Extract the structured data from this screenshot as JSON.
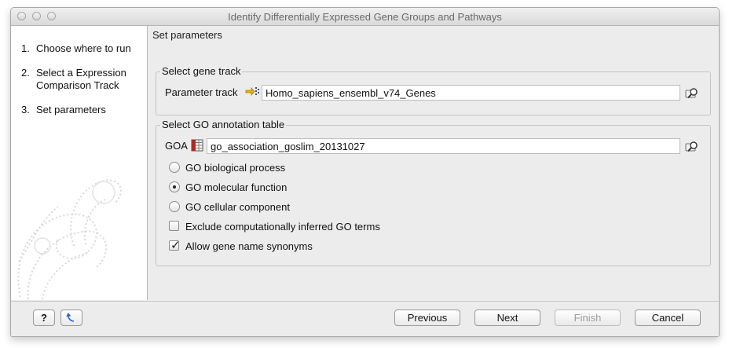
{
  "window": {
    "title": "Identify Differentially Expressed Gene Groups and Pathways"
  },
  "sidebar": {
    "steps": [
      {
        "num": "1.",
        "label": "Choose where to run"
      },
      {
        "num": "2.",
        "label": "Select a Expression Comparison Track"
      },
      {
        "num": "3.",
        "label": "Set parameters"
      }
    ]
  },
  "main": {
    "title": "Set parameters",
    "gene_track_group": {
      "legend": "Select gene track",
      "label": "Parameter track",
      "value": "Homo_sapiens_ensembl_v74_Genes"
    },
    "go_group": {
      "legend": "Select GO annotation table",
      "label": "GOA",
      "value": "go_association_goslim_20131027",
      "radios": [
        {
          "label": "GO biological process",
          "selected": false
        },
        {
          "label": "GO molecular function",
          "selected": true
        },
        {
          "label": "GO cellular component",
          "selected": false
        }
      ],
      "checkboxes": [
        {
          "label": "Exclude computationally inferred GO terms",
          "checked": false
        },
        {
          "label": "Allow gene name synonyms",
          "checked": true
        }
      ]
    }
  },
  "footer": {
    "help": "?",
    "previous": "Previous",
    "next": "Next",
    "finish": "Finish",
    "cancel": "Cancel"
  }
}
